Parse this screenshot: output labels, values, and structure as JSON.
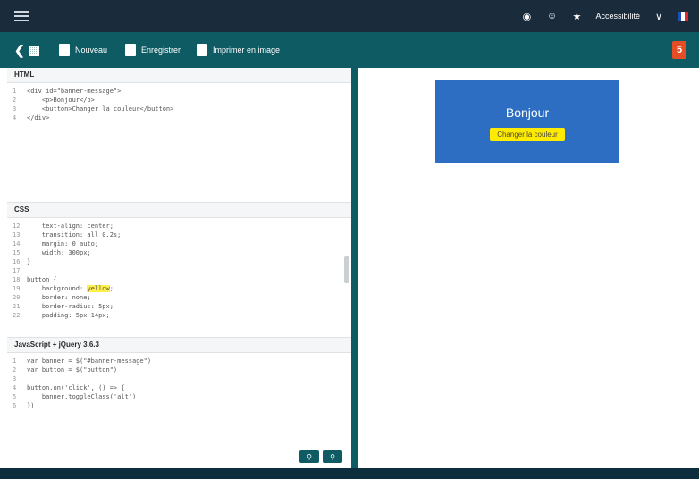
{
  "topbar": {
    "menu_icon": "hamburger-icon",
    "right": {
      "camera_icon": "camera-icon",
      "account_icon": "user-circle-icon",
      "fav_icon": "star-icon",
      "link_label": "Accessibilité",
      "share_icon": "share-icon",
      "lang_flag": "fr"
    }
  },
  "toolbar": {
    "back_icon": "back-arrow-icon",
    "buttons": [
      {
        "label": "Nouveau",
        "icon": "file-icon"
      },
      {
        "label": "Enregistrer",
        "icon": "save-icon"
      },
      {
        "label": "Imprimer en image",
        "icon": "image-icon"
      }
    ],
    "html5_badge": "5"
  },
  "editor": {
    "html": {
      "title": "HTML",
      "lines": [
        {
          "n": "1",
          "code": "<div id=\"banner-message\">"
        },
        {
          "n": "2",
          "code": "    <p>Bonjour</p>"
        },
        {
          "n": "3",
          "code": "    <button>Changer la couleur</button>"
        },
        {
          "n": "4",
          "code": "</div>"
        }
      ]
    },
    "css": {
      "title": "CSS",
      "lines": [
        {
          "n": "12",
          "code": "    text-align: center;"
        },
        {
          "n": "13",
          "code": "    transition: all 0.2s;"
        },
        {
          "n": "14",
          "code": "    margin: 0 auto;"
        },
        {
          "n": "15",
          "code": "    width: 300px;"
        },
        {
          "n": "16",
          "code": "}"
        },
        {
          "n": "17",
          "code": ""
        },
        {
          "n": "18",
          "code": "button {"
        },
        {
          "n": "19",
          "code": "    background: yellow;"
        },
        {
          "n": "20",
          "code": "    border: none;"
        },
        {
          "n": "21",
          "code": "    border-radius: 5px;"
        },
        {
          "n": "22",
          "code": "    padding: 5px 14px;"
        }
      ]
    },
    "js": {
      "title": "JavaScript + jQuery 3.6.3",
      "lines": [
        {
          "n": "1",
          "code": "var banner = $(\"#banner-message\")"
        },
        {
          "n": "2",
          "code": "var button = $(\"button\")"
        },
        {
          "n": "3",
          "code": ""
        },
        {
          "n": "4",
          "code": "button.on('click', () => {"
        },
        {
          "n": "5",
          "code": "    banner.toggleClass('alt')"
        },
        {
          "n": "6",
          "code": "})"
        }
      ]
    },
    "zoom_in_icon": "zoom-in-icon",
    "zoom_out_icon": "zoom-out-icon"
  },
  "preview": {
    "banner_text": "Bonjour",
    "button_text": "Changer la couleur"
  },
  "colors": {
    "topbar": "#1a2b3c",
    "toolbar": "#0e5b63",
    "banner": "#2d6ec2",
    "button": "#ffeb00"
  }
}
